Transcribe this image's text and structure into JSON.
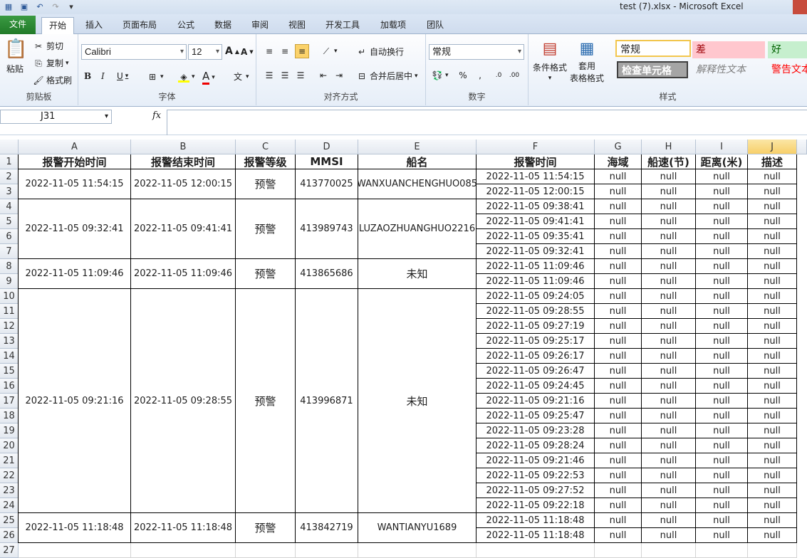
{
  "window": {
    "title": "test (7).xlsx  -  Microsoft Excel"
  },
  "tabs": [
    "文件",
    "开始",
    "插入",
    "页面布局",
    "公式",
    "数据",
    "审阅",
    "视图",
    "开发工具",
    "加载项",
    "团队"
  ],
  "ribbon": {
    "clipboard": {
      "paste": "粘贴",
      "cut": "剪切",
      "copy": "复制",
      "format_painter": "格式刷",
      "label": "剪贴板"
    },
    "font": {
      "name": "Calibri",
      "size": "12",
      "label": "字体"
    },
    "alignment": {
      "wrap": "自动换行",
      "merge": "合并后居中",
      "label": "对齐方式"
    },
    "number": {
      "format": "常规",
      "label": "数字"
    },
    "styles": {
      "conditional": "条件格式",
      "table_format_1": "套用",
      "table_format_2": "表格格式",
      "normal": "常规",
      "bad": "差",
      "good": "好",
      "check_cell": "检查单元格",
      "explanatory": "解释性文本",
      "warning": "警告文本",
      "label": "样式"
    }
  },
  "formula_bar": {
    "name_box": "J31",
    "fx": "fx"
  },
  "columns": [
    "A",
    "B",
    "C",
    "D",
    "E",
    "F",
    "G",
    "H",
    "I",
    "J"
  ],
  "rows": [
    "1",
    "2",
    "3",
    "4",
    "5",
    "6",
    "7",
    "8",
    "9",
    "10",
    "11",
    "12",
    "13",
    "14",
    "15",
    "16",
    "17",
    "18",
    "19",
    "20",
    "21",
    "22",
    "23",
    "24",
    "25",
    "26",
    "27"
  ],
  "headers": [
    "报警开始时间",
    "报警结束时间",
    "报警等级",
    "MMSI",
    "船名",
    "报警时间",
    "海域",
    "船速(节)",
    "距离(米)",
    "描述"
  ],
  "groups": [
    {
      "start": "2022-11-05 11:54:15",
      "end": "2022-11-05 12:00:15",
      "level": "预警",
      "mmsi": "413770025",
      "name": "WANXUANCHENGHUO085",
      "times": [
        "2022-11-05 11:54:15",
        "2022-11-05 12:00:15"
      ]
    },
    {
      "start": "2022-11-05 09:32:41",
      "end": "2022-11-05 09:41:41",
      "level": "预警",
      "mmsi": "413989743",
      "name": "LUZAOZHUANGHUO2216",
      "times": [
        "2022-11-05 09:38:41",
        "2022-11-05 09:41:41",
        "2022-11-05 09:35:41",
        "2022-11-05 09:32:41"
      ]
    },
    {
      "start": "2022-11-05 11:09:46",
      "end": "2022-11-05 11:09:46",
      "level": "预警",
      "mmsi": "413865686",
      "name": "未知",
      "times": [
        "2022-11-05 11:09:46",
        "2022-11-05 11:09:46"
      ]
    },
    {
      "start": "2022-11-05 09:21:16",
      "end": "2022-11-05 09:28:55",
      "level": "预警",
      "mmsi": "413996871",
      "name": "未知",
      "times": [
        "2022-11-05 09:24:05",
        "2022-11-05 09:28:55",
        "2022-11-05 09:27:19",
        "2022-11-05 09:25:17",
        "2022-11-05 09:26:17",
        "2022-11-05 09:26:47",
        "2022-11-05 09:24:45",
        "2022-11-05 09:21:16",
        "2022-11-05 09:25:47",
        "2022-11-05 09:23:28",
        "2022-11-05 09:28:24",
        "2022-11-05 09:21:46",
        "2022-11-05 09:22:53",
        "2022-11-05 09:27:52",
        "2022-11-05 09:22:18"
      ]
    },
    {
      "start": "2022-11-05 11:18:48",
      "end": "2022-11-05 11:18:48",
      "level": "预警",
      "mmsi": "413842719",
      "name": "WANTIANYU1689",
      "times": [
        "2022-11-05 11:18:48",
        "2022-11-05 11:18:48"
      ]
    }
  ],
  "null_text": "null",
  "selected_column": "J"
}
